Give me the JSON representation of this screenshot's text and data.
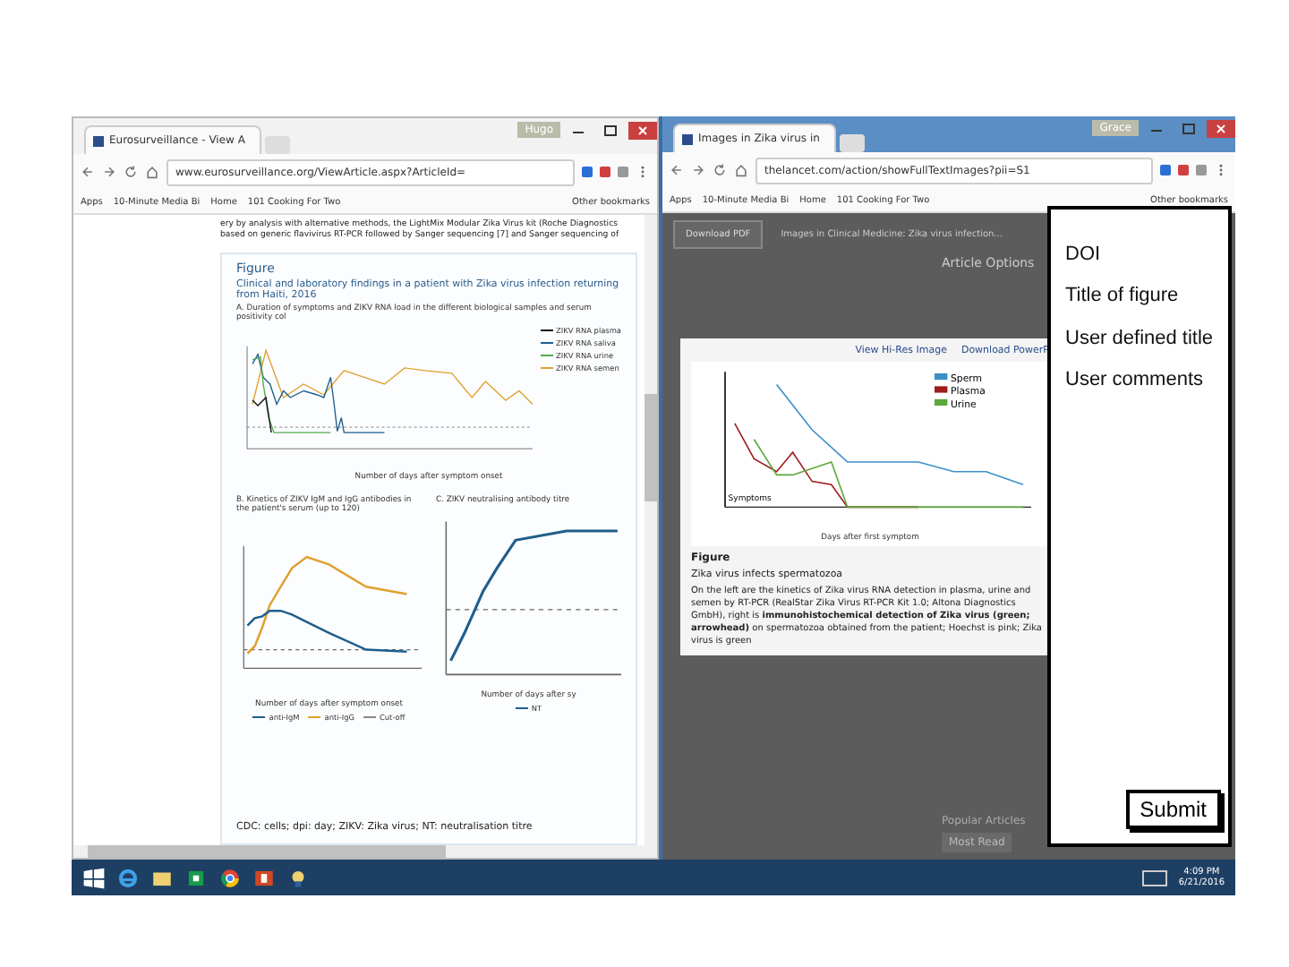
{
  "left_window": {
    "tab": "Eurosurveillance - View A",
    "user": "Hugo",
    "url": "www.eurosurveillance.org/ViewArticle.aspx?ArticleId=",
    "bookmarks": [
      "Apps",
      "10-Minute Media Bi",
      "Home",
      "101 Cooking For Two"
    ],
    "other_bookmarks": "Other bookmarks",
    "intro_lines": [
      "ery by analysis with alternative methods, the LightMix Modular Zika Virus kit (Roche Diagnostics",
      "based on generic flavivirus RT-PCR followed by Sanger sequencing [7] and Sanger sequencing of"
    ],
    "figure": {
      "heading": "Figure",
      "caption": "Clinical and laboratory findings in a patient with Zika virus infection returning from Haiti, 2016",
      "panel_a": {
        "title": "A. Duration of symptoms and ZIKV RNA load in the different biological samples and serum positivity col",
        "legend": [
          "ZIKV RNA plasma",
          "ZIKV RNA saliva",
          "ZIKV RNA urine",
          "ZIKV RNA semen"
        ],
        "xlabel": "Number of days after symptom onset"
      },
      "panel_b": {
        "title": "B. Kinetics of ZIKV IgM and IgG antibodies in the patient's serum (up to 120)",
        "xlabel": "Number of days after symptom onset",
        "legend": [
          "anti-IgM",
          "anti-IgG",
          "Cut-off"
        ]
      },
      "panel_c": {
        "title": "C. ZIKV neutralising antibody titre",
        "xlabel": "Number of days after sy",
        "legend": [
          "NT"
        ]
      },
      "footnote": "CDC: cells; dpi: day; ZIKV: Zika virus; NT: neutralisation titre"
    }
  },
  "right_window": {
    "tab": "Images in Zika virus in",
    "user": "Grace",
    "url": "thelancet.com/action/showFullTextImages?pii=S1",
    "bookmarks": [
      "Apps",
      "10-Minute Media Bi",
      "Home",
      "101 Cooking For Two"
    ],
    "other_bookmarks": "Other bookmarks",
    "download_pdf": "Download PDF",
    "article_title": "Images in Clinical Medicine: Zika virus infection...",
    "article_options": "Article Options",
    "modal": {
      "links": [
        "View Hi-Res Image",
        "Download PowerP"
      ],
      "legend": [
        "Sperm",
        "Plasma",
        "Urine"
      ],
      "xlabel": "Days after first symptom",
      "symptoms": "Symptoms",
      "heading": "Figure",
      "title": "Zika virus infects spermatozoa",
      "text": "On the left are the kinetics of Zika virus RNA detection in plasma, urine and semen by RT-PCR (RealStar Zika Virus RT-PCR Kit 1.0; Altona Diagnostics GmbH), right is **immunohistochemical detection of Zika virus (green; arrowhead)** on spermatozoa obtained from the patient; Hoechst is pink; Zika virus is green"
    },
    "popular": "Popular Articles",
    "most_read": "Most Read"
  },
  "annotation_panel": {
    "fields": [
      "DOI",
      "Title of figure",
      "User defined title",
      "User comments"
    ],
    "submit": "Submit"
  },
  "taskbar": {
    "time": "4:09 PM",
    "date": "6/21/2016"
  }
}
